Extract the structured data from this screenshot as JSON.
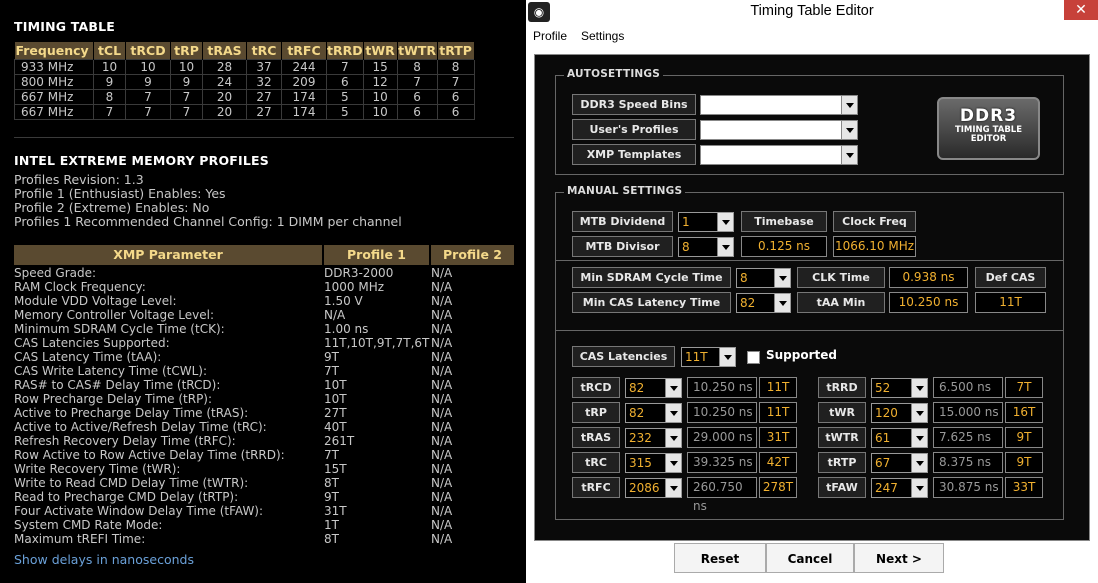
{
  "timing_table": {
    "title": "TIMING TABLE",
    "headers": [
      "Frequency",
      "tCL",
      "tRCD",
      "tRP",
      "tRAS",
      "tRC",
      "tRFC",
      "tRRD",
      "tWR",
      "tWTR",
      "tRTP"
    ],
    "rows": [
      [
        "933 MHz",
        "10",
        "10",
        "10",
        "28",
        "37",
        "244",
        "7",
        "15",
        "8",
        "8"
      ],
      [
        "800 MHz",
        "9",
        "9",
        "9",
        "24",
        "32",
        "209",
        "6",
        "12",
        "7",
        "7"
      ],
      [
        "667 MHz",
        "8",
        "7",
        "7",
        "20",
        "27",
        "174",
        "5",
        "10",
        "6",
        "6"
      ],
      [
        "667 MHz",
        "7",
        "7",
        "7",
        "20",
        "27",
        "174",
        "5",
        "10",
        "6",
        "6"
      ]
    ]
  },
  "xmp": {
    "title": "INTEL EXTREME MEMORY PROFILES",
    "info": [
      "Profiles Revision: 1.3",
      "Profile 1 (Enthusiast) Enables: Yes",
      "Profile 2 (Extreme) Enables: No",
      "Profiles 1 Recommended Channel Config: 1 DIMM per channel"
    ],
    "headers": [
      "XMP Parameter",
      "Profile 1",
      "Profile 2"
    ],
    "rows": [
      [
        "Speed Grade:",
        "DDR3-2000",
        "N/A"
      ],
      [
        "RAM Clock Frequency:",
        "1000 MHz",
        "N/A"
      ],
      [
        "Module VDD Voltage Level:",
        "1.50 V",
        "N/A"
      ],
      [
        "Memory Controller Voltage Level:",
        "N/A",
        "N/A"
      ],
      [
        "Minimum SDRAM Cycle Time (tCK):",
        "1.00 ns",
        "N/A"
      ],
      [
        "CAS Latencies Supported:",
        "11T,10T,9T,7T,6T",
        "N/A"
      ],
      [
        "CAS Latency Time (tAA):",
        "9T",
        "N/A"
      ],
      [
        "CAS Write Latency Time (tCWL):",
        "7T",
        "N/A"
      ],
      [
        "RAS# to CAS# Delay Time (tRCD):",
        "10T",
        "N/A"
      ],
      [
        "Row Precharge Delay Time (tRP):",
        "10T",
        "N/A"
      ],
      [
        "Active to Precharge Delay Time (tRAS):",
        "27T",
        "N/A"
      ],
      [
        "Active to Active/Refresh Delay Time (tRC):",
        "40T",
        "N/A"
      ],
      [
        "Refresh Recovery Delay Time (tRFC):",
        "261T",
        "N/A"
      ],
      [
        "Row Active to Row Active Delay Time (tRRD):",
        "7T",
        "N/A"
      ],
      [
        "Write Recovery Time (tWR):",
        "15T",
        "N/A"
      ],
      [
        "Write to Read CMD Delay Time (tWTR):",
        "8T",
        "N/A"
      ],
      [
        "Read to Precharge CMD Delay (tRTP):",
        "9T",
        "N/A"
      ],
      [
        "Four Activate Window Delay Time (tFAW):",
        "31T",
        "N/A"
      ],
      [
        "System CMD Rate Mode:",
        "1T",
        "N/A"
      ],
      [
        "Maximum tREFI Time:",
        "8T",
        "N/A"
      ]
    ],
    "link": "Show delays in nanoseconds"
  },
  "window": {
    "title": "Timing Table Editor",
    "close": "✕",
    "menu": [
      "Profile",
      "Settings"
    ],
    "badge": {
      "line1": "DDR3",
      "line2": "TIMING TABLE",
      "line3": "EDITOR"
    },
    "autosettings": {
      "title": "AUTOSETTINGS",
      "items": [
        {
          "label": "DDR3 Speed Bins",
          "value": ""
        },
        {
          "label": "User's Profiles",
          "value": ""
        },
        {
          "label": "XMP Templates",
          "value": ""
        }
      ]
    },
    "manual": {
      "title": "MANUAL SETTINGS",
      "mtb_dividend_label": "MTB Dividend",
      "mtb_dividend": "1",
      "mtb_divisor_label": "MTB Divisor",
      "mtb_divisor": "8",
      "timebase_label": "Timebase",
      "timebase": "0.125 ns",
      "clockfreq_label": "Clock Freq",
      "clockfreq": "1066.10 MHz",
      "min_cycle_label": "Min SDRAM Cycle Time",
      "min_cycle": "8",
      "clk_time_label": "CLK Time",
      "clk_time": "0.938 ns",
      "def_cas_label": "Def CAS",
      "def_cas": "11T",
      "min_cas_label": "Min CAS Latency Time",
      "min_cas": "82",
      "taa_label": "tAA Min",
      "taa": "10.250 ns",
      "cas_lat_label": "CAS Latencies",
      "cas_lat": "11T",
      "supported_label": "Supported"
    },
    "timings_left": [
      {
        "name": "tRCD",
        "raw": "82",
        "ns": "10.250 ns",
        "t": "11T"
      },
      {
        "name": "tRP",
        "raw": "82",
        "ns": "10.250 ns",
        "t": "11T"
      },
      {
        "name": "tRAS",
        "raw": "232",
        "ns": "29.000 ns",
        "t": "31T"
      },
      {
        "name": "tRC",
        "raw": "315",
        "ns": "39.325 ns",
        "t": "42T"
      },
      {
        "name": "tRFC",
        "raw": "2086",
        "ns": "260.750 ns",
        "t": "278T"
      }
    ],
    "timings_right": [
      {
        "name": "tRRD",
        "raw": "52",
        "ns": "6.500 ns",
        "t": "7T"
      },
      {
        "name": "tWR",
        "raw": "120",
        "ns": "15.000 ns",
        "t": "16T"
      },
      {
        "name": "tWTR",
        "raw": "61",
        "ns": "7.625 ns",
        "t": "9T"
      },
      {
        "name": "tRTP",
        "raw": "67",
        "ns": "8.375 ns",
        "t": "9T"
      },
      {
        "name": "tFAW",
        "raw": "247",
        "ns": "30.875 ns",
        "t": "33T"
      }
    ],
    "buttons": {
      "reset": "Reset",
      "cancel": "Cancel",
      "next": "Next >"
    }
  }
}
